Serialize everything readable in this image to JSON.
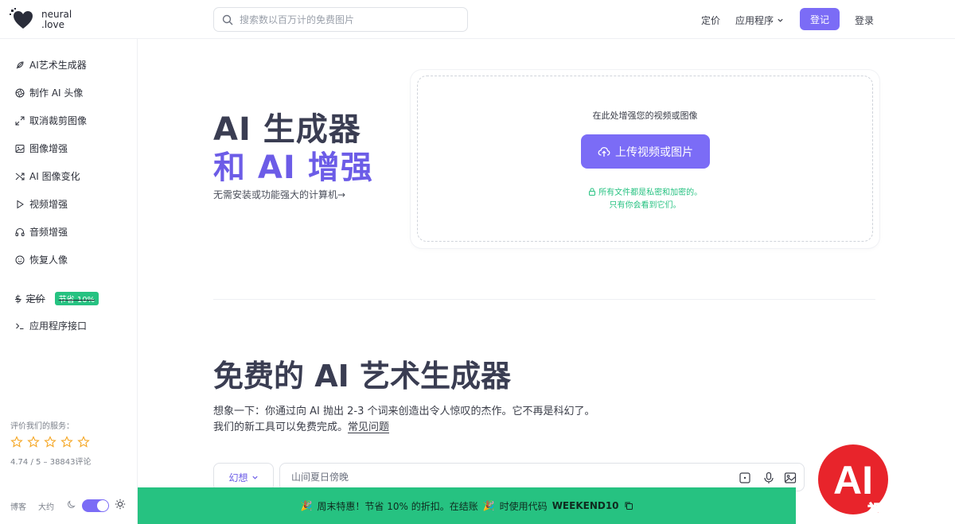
{
  "brand": {
    "line1": "neural",
    "line2": ".love"
  },
  "header": {
    "search_placeholder": "搜索数以百万计的免费图片",
    "pricing": "定价",
    "apps": "应用程序",
    "signup": "登记",
    "login": "登录"
  },
  "sidebar": {
    "items": [
      {
        "label": "AI艺术生成器",
        "icon": "feather-icon"
      },
      {
        "label": "制作 AI 头像",
        "icon": "aperture-icon"
      },
      {
        "label": "取消裁剪图像",
        "icon": "expand-icon"
      },
      {
        "label": "图像增强",
        "icon": "image-icon"
      },
      {
        "label": "AI 图像变化",
        "icon": "shuffle-icon"
      },
      {
        "label": "视频增强",
        "icon": "play-icon"
      },
      {
        "label": "音频增强",
        "icon": "headphones-icon"
      },
      {
        "label": "恢复人像",
        "icon": "smile-icon"
      }
    ],
    "pricing": {
      "symbol": "$",
      "label": "定价",
      "badge": "节省 10%"
    },
    "api": "应用程序接口",
    "rating_label": "评价我们的服务：",
    "rating_score": "4.74 / 5 – 38843评论",
    "rating_stars": 5,
    "footer_blog": "博客",
    "footer_about": "大约"
  },
  "hero": {
    "title_line1": "AI 生成器",
    "title_line2": "和 AI 增强",
    "subtitle": "无需安装或功能强大的计算机→"
  },
  "upload": {
    "hint": "在此处增强您的视频或图像",
    "button": "上传视频或图片",
    "privacy_line1": "所有文件都是私密和加密的。",
    "privacy_line2": "只有你会看到它们。"
  },
  "section": {
    "title": "免费的 AI 艺术生成器",
    "desc_line1": "想象一下：你通过向 AI 抛出 2-3 个词来创造出令人惊叹的杰作。它不再是科幻了。",
    "desc_line2": "我们的新工具可以免费完成。",
    "faq": "常见问题"
  },
  "generator": {
    "style": "幻想",
    "prompt_placeholder": "山间夏日傍晚"
  },
  "promo": {
    "text1": "周末特惠！节省 10% 的折扣。在结账",
    "text2": "时使用代码",
    "code": "WEEKEND10"
  },
  "watermark": {
    "big": "AI",
    "small": "视频贴吧"
  },
  "colors": {
    "accent": "#7b6cf6",
    "accent_text": "#6c5ce7",
    "green": "#26c281",
    "star": "#f5a623"
  }
}
